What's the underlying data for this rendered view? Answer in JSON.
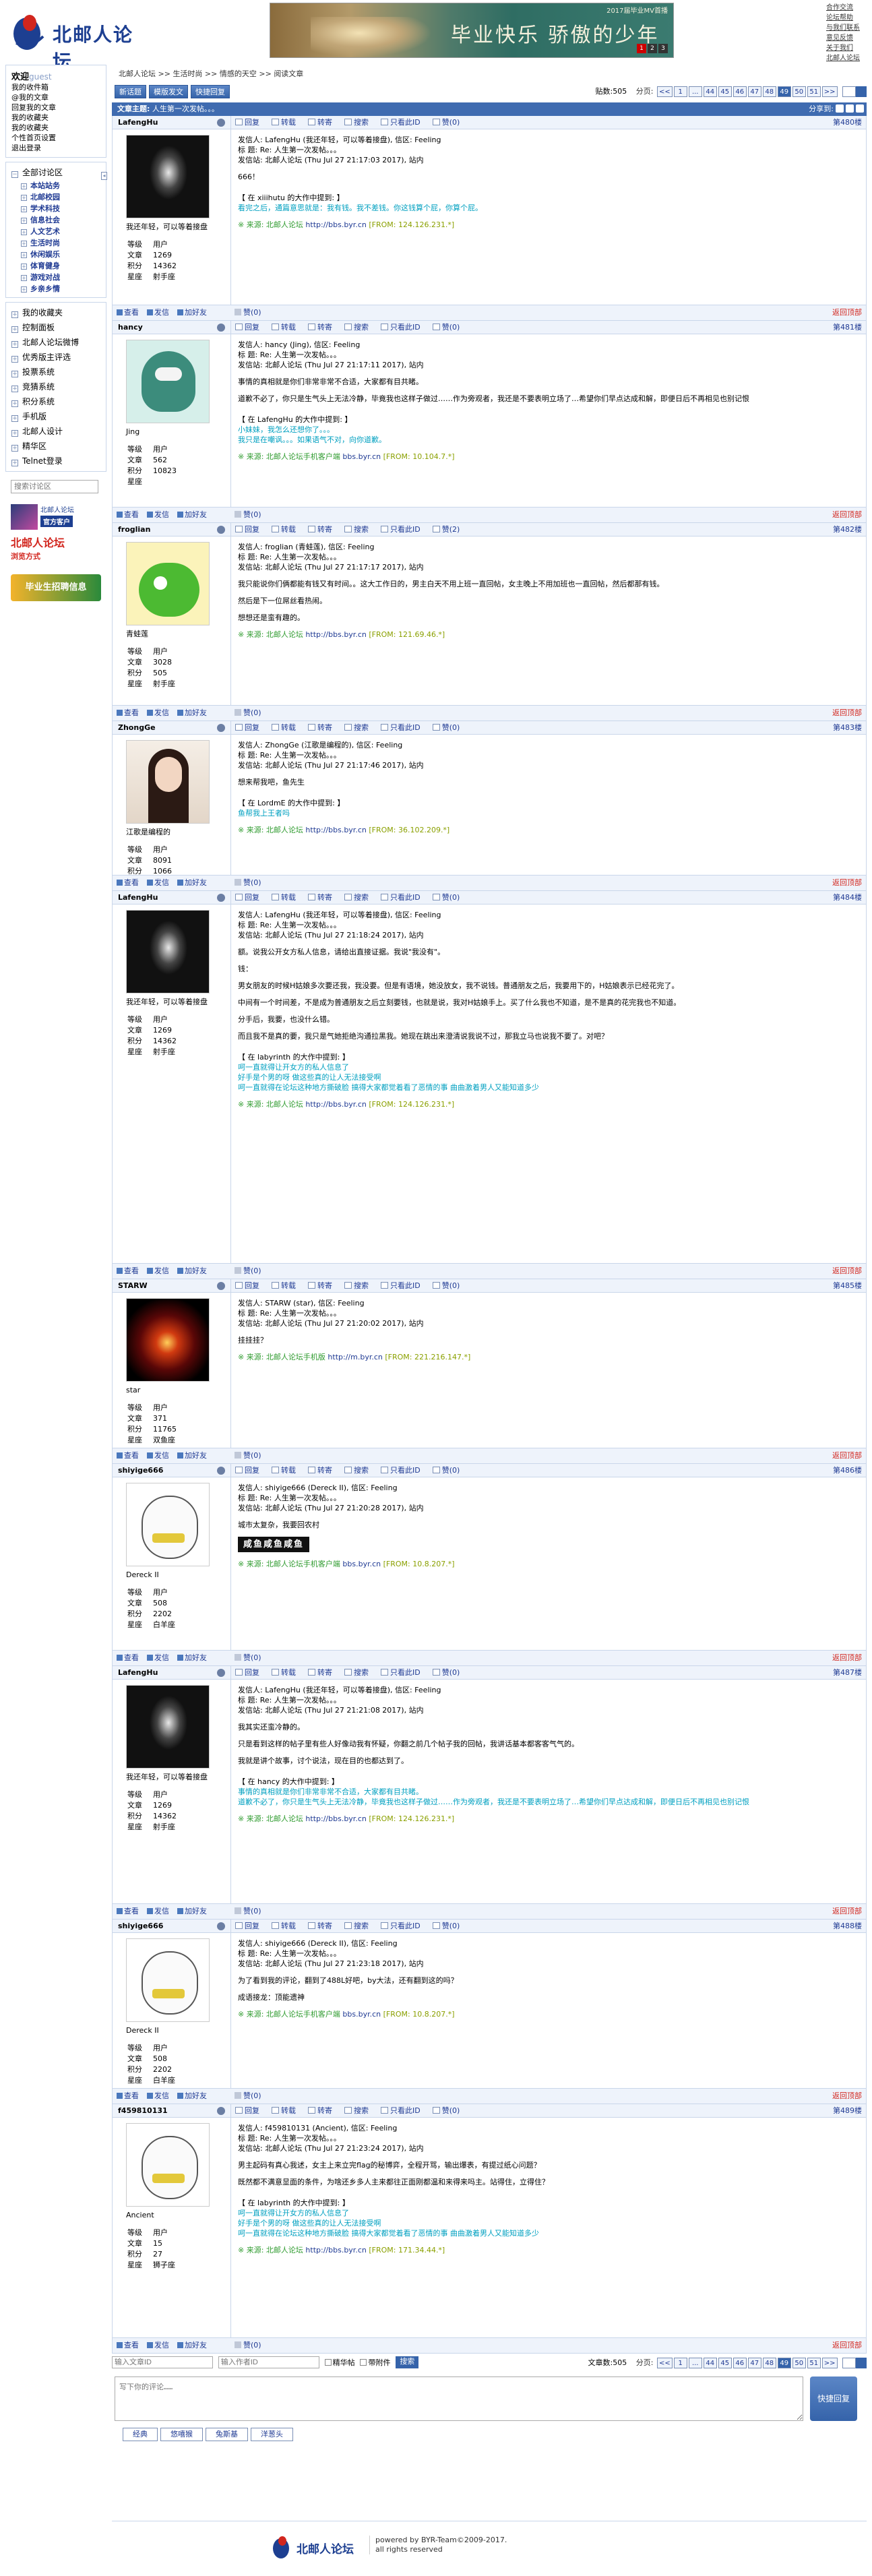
{
  "header": {
    "logo_text": "北邮人论坛",
    "banner_title": "毕业快乐 骄傲的少年",
    "banner_top": "2017届毕业MV首播",
    "banner_pages": [
      "1",
      "2",
      "3"
    ],
    "toplinks": [
      "合作交流",
      "论坛帮助",
      "与我们联系",
      "意见反馈",
      "关于我们",
      "北邮人论坛"
    ]
  },
  "sidebar": {
    "welcome": "欢迎",
    "guest": "guest",
    "user_links": [
      "我的收件箱",
      "@我的文章",
      "回复我的文章",
      "我的收藏夹",
      "我的收藏夹",
      "个性首页设置",
      "退出登录"
    ],
    "all_sections": "全部讨论区",
    "sections": [
      "本站站务",
      "北邮校园",
      "学术科技",
      "信息社会",
      "人文艺术",
      "生活时尚",
      "休闲娱乐",
      "体育健身",
      "游戏对战",
      "乡亲乡情"
    ],
    "menu": [
      "我的收藏夹",
      "控制面板",
      "北邮人论坛微博",
      "优秀版主评选",
      "投票系统",
      "竞猜系统",
      "积分系统",
      "手机版",
      "北邮人设计",
      "精华区",
      "Telnet登录"
    ],
    "search_placeholder": "搜索讨论区",
    "promo1_title": "北邮人论坛",
    "promo1_btn": "官方客户",
    "promo2_title": "北邮人论坛",
    "promo2_sub": "浏览方式",
    "promo3": "毕业生招聘信息"
  },
  "breadcrumb": [
    "北邮人论坛",
    "生活时尚",
    "情感的天空",
    "阅读文章"
  ],
  "toolbar": {
    "buttons": [
      "新话题",
      "模版发文",
      "快捷回复"
    ],
    "count_label": "贴数:505",
    "page_label": "分页:",
    "pages": [
      "<<",
      "1",
      "...",
      "44",
      "45",
      "46",
      "47",
      "48",
      "49",
      "50",
      "51",
      ">>"
    ],
    "current_page": "49"
  },
  "thread": {
    "label": "文章主题:",
    "title": "人生第一次发帖。。。",
    "share": "分享到:"
  },
  "post_actions": [
    "回复",
    "转载",
    "转寄",
    "搜索",
    "只看此ID",
    "赞(0)"
  ],
  "foot_actions": [
    "查看",
    "发信",
    "加好友"
  ],
  "foot_like": "赞(0)",
  "to_top": "返回顶部",
  "stat_labels": [
    "等级",
    "文章",
    "积分",
    "星座"
  ],
  "posts": [
    {
      "user": "LafengHu",
      "floor": "第480楼",
      "sig": "我还年轻，可以等着接盘",
      "stats": [
        "用户",
        "1269",
        "14362",
        "射手座"
      ],
      "likes": "赞(0)",
      "meta": [
        "发信人: LafengHu (我还年轻，可以等着接盘), 信区: Feeling",
        "标  题: Re: 人生第一次发帖。。。",
        "发信站: 北邮人论坛 (Thu Jul 27 21:17:03 2017), 站内"
      ],
      "text": [
        "666！"
      ],
      "quote_head": "【 在 xiiihutu 的大作中提到: 】",
      "quote": [
        "看完之后，通篇意思就是：我有钱。我不差钱。你这钱算个屁，你算个屁。"
      ],
      "src_prefix": "※ 来源: 北邮人论坛",
      "src_link": "http://bbs.byr.cn",
      "src_ip": "[FROM: 124.126.231.*]"
    },
    {
      "user": "hancy",
      "floor": "第481楼",
      "sig": "Jing",
      "stats": [
        "用户",
        "562",
        "10823",
        ""
      ],
      "likes": "赞(0)",
      "meta": [
        "发信人: hancy (Jing), 信区: Feeling",
        "标  题: Re: 人生第一次发帖。。。",
        "发信站: 北邮人论坛 (Thu Jul 27 21:17:11 2017), 站内"
      ],
      "text": [
        "事情的真相就是你们非常非常不合适，大家都有目共睹。",
        "道歉不必了，你只是生气头上无法冷静，毕竟我也这样子做过……作为旁观者，我还是不要表明立场了…希望你们早点达成和解，即便日后不再相见也别记恨"
      ],
      "quote_head": "【 在 LafengHu 的大作中提到: 】",
      "quote": [
        "小妹妹，我怎么还想你了。。。",
        "",
        "我只是在嘲讽。。。如果语气不对，向你道歉。"
      ],
      "src_prefix": "※ 来源: 北邮人论坛手机客户端",
      "src_link": "bbs.byr.cn",
      "src_ip": "[FROM: 10.104.7.*]"
    },
    {
      "user": "froglian",
      "floor": "第482楼",
      "sig": "青蛙莲",
      "stats": [
        "用户",
        "3028",
        "505",
        "射手座"
      ],
      "likes": "赞(2)",
      "meta": [
        "发信人: froglian (青蛙莲), 信区: Feeling",
        "标  题: Re: 人生第一次发帖。。。",
        "发信站: 北邮人论坛 (Thu Jul 27 21:17:17 2017), 站内"
      ],
      "text": [
        "我只能说你们俩都能有钱又有时间。。这大工作日的，男主白天不用上班一直回帖，女主晚上不用加班也一直回帖，然后都那有钱。",
        "然后是下一位屌丝看热闹。",
        "想想还是蛮有趣的。"
      ],
      "quote_head": "",
      "quote": [],
      "src_prefix": "※ 来源: 北邮人论坛",
      "src_link": "http://bbs.byr.cn",
      "src_ip": "[FROM: 121.69.46.*]"
    },
    {
      "user": "ZhongGe",
      "floor": "第483楼",
      "sig": "江歌是编程的",
      "stats": [
        "用户",
        "8091",
        "1066",
        "白羊座"
      ],
      "likes": "赞(0)",
      "meta": [
        "发信人: ZhongGe (江歌是编程的), 信区: Feeling",
        "标  题: Re: 人生第一次发帖。。。",
        "发信站: 北邮人论坛 (Thu Jul 27 21:17:46 2017), 站内"
      ],
      "text": [
        "想来帮我吧，鱼先生"
      ],
      "quote_head": "【 在 LordmE 的大作中提到: 】",
      "quote": [
        "",
        "鱼帮我上王者吗"
      ],
      "src_prefix": "※ 来源: 北邮人论坛",
      "src_link": "http://bbs.byr.cn",
      "src_ip": "[FROM: 36.102.209.*]"
    },
    {
      "user": "LafengHu",
      "floor": "第484楼",
      "sig": "我还年轻，可以等着接盘",
      "stats": [
        "用户",
        "1269",
        "14362",
        "射手座"
      ],
      "likes": "赞(0)",
      "meta": [
        "发信人: LafengHu (我还年轻，可以等着接盘), 信区: Feeling",
        "标  题: Re: 人生第一次发帖。。。",
        "发信站: 北邮人论坛 (Thu Jul 27 21:18:24 2017), 站内"
      ],
      "text": [
        "额。说我公开女方私人信息，请给出直接证据。我说\"我没有\"。",
        "钱：",
        "男女朋友的时候H姑娘多次要还我，我没要。但是有语境，她没放女，我不说钱。普通朋友之后，我要用下的，H姑娘表示已经花完了。",
        "中间有一个时间差，不是成为普通朋友之后立刻要钱，也就是说，我对H姑娘手上。买了什么我也不知道，是不是真的花完我也不知道。",
        "分手后，我要，也没什么错。",
        "而且我不是真的要，我只是气她拒绝沟通拉黑我。她现在跳出来澄清说我说不过，那我立马也说我不要了。对吧？"
      ],
      "quote_head": "【 在 labyrinth 的大作中提到: 】",
      "quote": [
        "呵一直就得让开女方的私人信息了",
        "好手是个男的呀 做这些真的让人无法接受啊",
        "呵一直就得在论坛这种地方撕破脸 搞得大家都觉着看了恶情的事 曲曲激着男人又能知道多少"
      ],
      "src_prefix": "※ 来源: 北邮人论坛",
      "src_link": "http://bbs.byr.cn",
      "src_ip": "[FROM: 124.126.231.*]"
    },
    {
      "user": "STARW",
      "floor": "第485楼",
      "sig": "star",
      "stats": [
        "用户",
        "371",
        "11765",
        "双鱼座"
      ],
      "likes": "赞(0)",
      "meta": [
        "发信人: STARW (star), 信区: Feeling",
        "标  题: Re: 人生第一次发帖。。。",
        "发信站: 北邮人论坛 (Thu Jul 27 21:20:02 2017), 站内"
      ],
      "text": [
        "挂挂挂？"
      ],
      "quote_head": "",
      "quote": [],
      "src_prefix": "※ 来源: 北邮人论坛手机版",
      "src_link": "http://m.byr.cn",
      "src_ip": "[FROM: 221.216.147.*]"
    },
    {
      "user": "shiyige666",
      "floor": "第486楼",
      "sig": "Dereck II",
      "stats": [
        "用户",
        "508",
        "2202",
        "白羊座"
      ],
      "likes": "赞(0)",
      "meta": [
        "发信人: shiyige666 (Dereck II), 信区: Feeling",
        "标  题: Re: 人生第一次发帖。。。",
        "发信站: 北邮人论坛 (Thu Jul 27 21:20:28 2017), 站内"
      ],
      "text": [
        "城市太复杂，我要回农村"
      ],
      "image_text": "咸鱼咸鱼咸鱼",
      "quote_head": "",
      "quote": [],
      "src_prefix": "※ 来源: 北邮人论坛手机客户端",
      "src_link": "bbs.byr.cn",
      "src_ip": "[FROM: 10.8.207.*]"
    },
    {
      "user": "LafengHu",
      "floor": "第487楼",
      "sig": "我还年轻，可以等着接盘",
      "stats": [
        "用户",
        "1269",
        "14362",
        "射手座"
      ],
      "likes": "赞(0)",
      "meta": [
        "发信人: LafengHu (我还年轻，可以等着接盘), 信区: Feeling",
        "标  题: Re: 人生第一次发帖。。。",
        "发信站: 北邮人论坛 (Thu Jul 27 21:21:08 2017), 站内"
      ],
      "text": [
        "我其实还蛮冷静的。",
        "只是看到这样的帖子里有些人好像动我有怀疑，你翻之前几个帖子我的回帖，我讲话基本都客客气气的。",
        "我就是讲个故事，讨个说法，现在目的也都达到了。"
      ],
      "quote_head": "【 在 hancy 的大作中提到: 】",
      "quote": [
        "事情的真相就是你们非常非常不合适，大家都有目共睹。",
        "道歉不必了，你只是生气头上无法冷静，毕竟我也这样子做过……作为旁观者，我还是不要表明立场了…希望你们早点达成和解，即便日后不再相见也别记恨"
      ],
      "src_prefix": "※ 来源: 北邮人论坛",
      "src_link": "http://bbs.byr.cn",
      "src_ip": "[FROM: 124.126.231.*]"
    },
    {
      "user": "shiyige666",
      "floor": "第488楼",
      "sig": "Dereck II",
      "stats": [
        "用户",
        "508",
        "2202",
        "白羊座"
      ],
      "likes": "赞(0)",
      "meta": [
        "发信人: shiyige666 (Dereck II), 信区: Feeling",
        "标  题: Re: 人生第一次发帖。。。",
        "发信站: 北邮人论坛 (Thu Jul 27 21:23:18 2017), 站内"
      ],
      "text": [
        "为了看到我的评论，翻到了488L好吧，by大法，还有翻到这的吗？",
        "成语接龙：顶能遗神"
      ],
      "quote_head": "",
      "quote": [],
      "src_prefix": "※ 来源: 北邮人论坛手机客户端",
      "src_link": "bbs.byr.cn",
      "src_ip": "[FROM: 10.8.207.*]"
    },
    {
      "user": "f459810131",
      "floor": "第489楼",
      "sig": "Ancient",
      "stats": [
        "用户",
        "15",
        "27",
        "狮子座"
      ],
      "likes": "赞(0)",
      "meta": [
        "发信人: f459810131 (Ancient), 信区: Feeling",
        "标  题: Re: 人生第一次发帖。。。",
        "发信站: 北邮人论坛 (Thu Jul 27 21:23:24 2017), 站内"
      ],
      "text": [
        "男主起码有真心我述，女主上来立完flag的秘博弈，全程开骂，输出爆表，有提过纸心问题？",
        "既然都不满意显面的条件，为啥还乡多人主来都往正面刚都温和来得来吗主。站得住，立得住？"
      ],
      "quote_head": "【 在 labyrinth 的大作中提到: 】",
      "quote": [
        "呵一直就得让开女方的私人信息了",
        "好手是个男的呀 做这些真的让人无法接受啊",
        "呵一直就得在论坛这种地方撕破脸 搞得大家都觉着看了恶情的事 曲曲激着男人又能知道多少"
      ],
      "src_prefix": "※ 来源: 北邮人论坛",
      "src_link": "http://bbs.byr.cn",
      "src_ip": "[FROM: 171.34.44.*]"
    }
  ],
  "bottom": {
    "user_placeholder": "输入文章ID",
    "id_placeholder": "输入作者ID",
    "chk1": "精华帖",
    "chk2": "带附件",
    "search_btn": "搜索",
    "count_label": "文章数:505",
    "page_label": "分页:"
  },
  "reply": {
    "placeholder": "写下你的评论……",
    "button": "快捷回复",
    "emoticons": [
      "经典",
      "悠嘻猴",
      "兔斯基",
      "洋葱头"
    ]
  },
  "footer": {
    "logo_text": "北邮人论坛",
    "copy1": "powered by BYR-Team©2009-2017.",
    "copy2": "all rights reserved"
  }
}
